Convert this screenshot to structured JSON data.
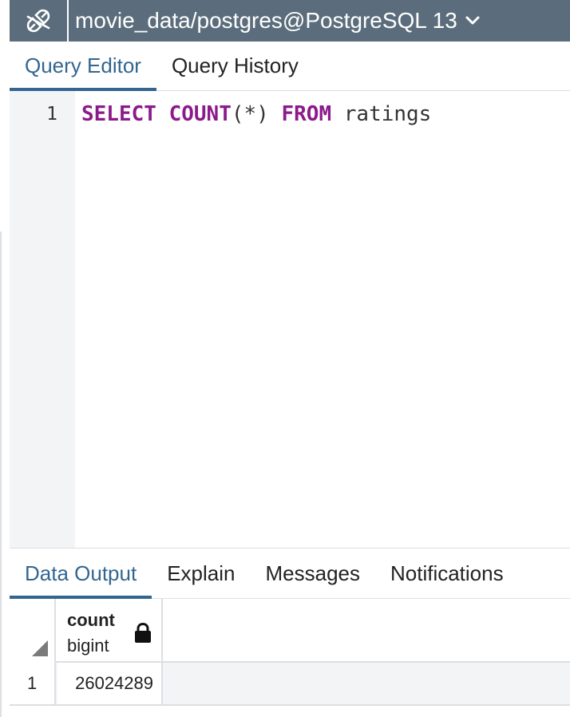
{
  "connection": {
    "title": "movie_data/postgres@PostgreSQL 13",
    "icon": "plug-connection-icon",
    "dropdown_icon": "chevron-down-icon"
  },
  "editor_tabs": [
    {
      "label": "Query Editor",
      "active": true
    },
    {
      "label": "Query History",
      "active": false
    }
  ],
  "editor": {
    "line_number": "1",
    "code": {
      "select": "SELECT",
      "count_fn": "COUNT",
      "args": "(*)",
      "from": "FROM",
      "table": "ratings"
    }
  },
  "output_tabs": [
    {
      "label": "Data Output",
      "active": true
    },
    {
      "label": "Explain",
      "active": false
    },
    {
      "label": "Messages",
      "active": false
    },
    {
      "label": "Notifications",
      "active": false
    }
  ],
  "result_grid": {
    "columns": [
      {
        "name": "count",
        "type": "bigint",
        "icon": "lock-icon"
      }
    ],
    "rows": [
      {
        "row_number": "1",
        "values": [
          "26024289"
        ]
      }
    ]
  },
  "colors": {
    "header_bg": "#5b6d7c",
    "accent": "#326690",
    "keyword": "#8b1a8b"
  }
}
